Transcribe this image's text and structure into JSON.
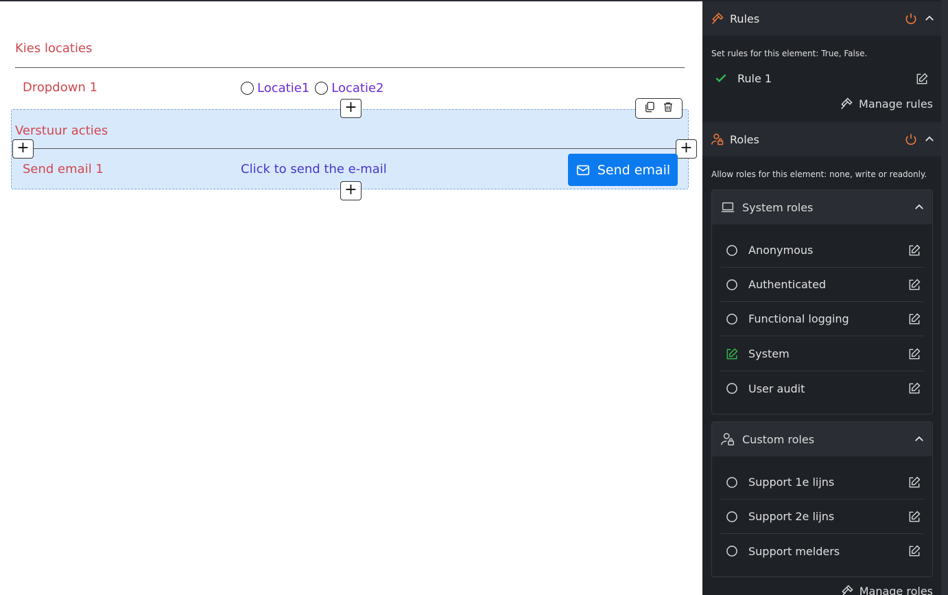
{
  "canvas": {
    "section1_title": "Kies locaties",
    "dropdown_label": "Dropdown 1",
    "radio_options": [
      "Locatie1",
      "Locatie2"
    ],
    "section2_title": "Verstuur acties",
    "send_label": "Send email 1",
    "send_text": "Click to send the e-mail",
    "send_button": "Send email",
    "plus": "+"
  },
  "sidebar": {
    "rules": {
      "title": "Rules",
      "help": "Set rules for this element: True, False.",
      "items": [
        "Rule 1"
      ],
      "manage": "Manage rules"
    },
    "roles": {
      "title": "Roles",
      "help": "Allow roles for this element: none, write or readonly.",
      "system": {
        "title": "System roles",
        "items": [
          "Anonymous",
          "Authenticated",
          "Functional logging",
          "System",
          "User audit"
        ]
      },
      "custom": {
        "title": "Custom roles",
        "items": [
          "Support 1e lijns",
          "Support 2e lijns",
          "Support melders"
        ]
      },
      "manage": "Manage roles"
    }
  },
  "colors": {
    "accent_orange": "#f07a3a",
    "check_green": "#2fb84f",
    "send_blue": "#0d7bf0"
  }
}
